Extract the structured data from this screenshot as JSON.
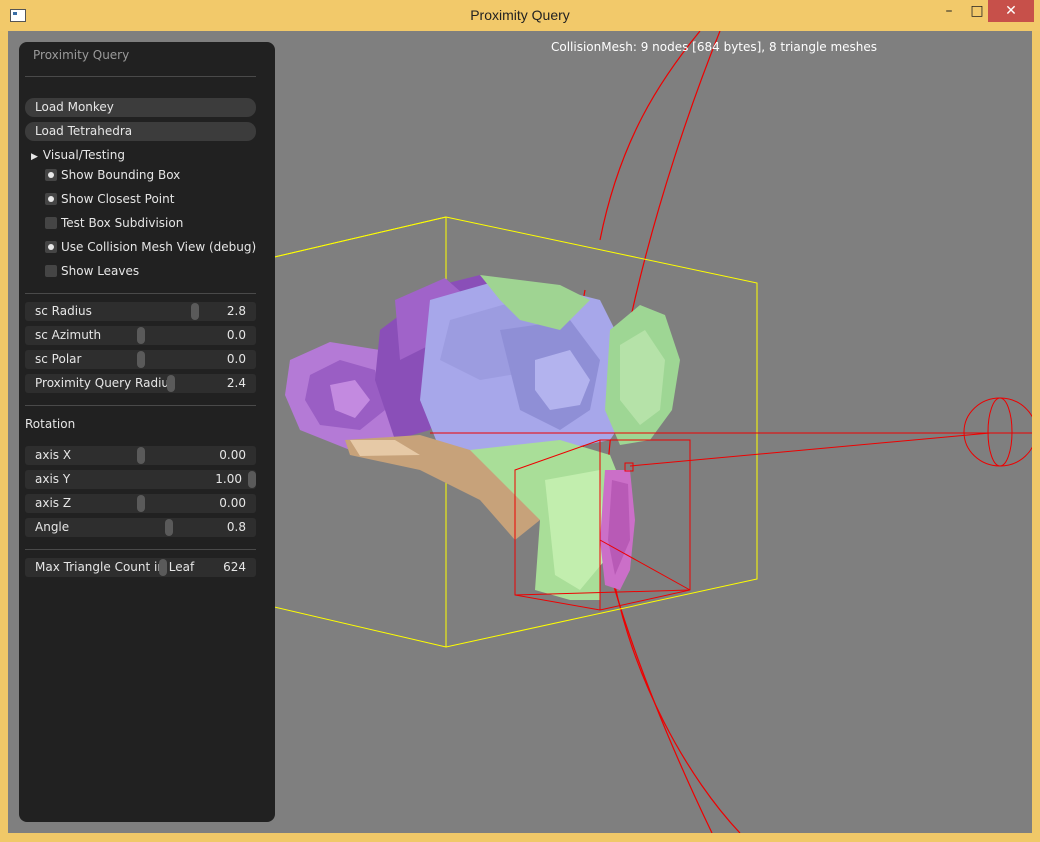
{
  "window": {
    "title": "Proximity Query",
    "controls": {
      "minimize": "–",
      "maximize": "□",
      "close": "✕"
    },
    "icon": "app-window-icon"
  },
  "viewport": {
    "info": "CollisionMesh: 9 nodes [684 bytes], 8 triangle meshes",
    "background": "#7f7f7f"
  },
  "panel": {
    "title": "Proximity Query",
    "buttons": {
      "load_monkey": "Load Monkey",
      "load_tetrahedra": "Load Tetrahedra"
    },
    "visual_testing": {
      "label": "Visual/Testing",
      "expanded_icon": "triangle-right-icon",
      "options": [
        {
          "label": "Show Bounding Box",
          "checked": true
        },
        {
          "label": "Show Closest Point",
          "checked": true
        },
        {
          "label": "Test Box Subdivision",
          "checked": false
        },
        {
          "label": "Use Collision Mesh View (debug)",
          "checked": true
        },
        {
          "label": "Show Leaves",
          "checked": false
        }
      ]
    },
    "sliders": {
      "sc_radius": {
        "label": "sc Radius",
        "value": "2.8",
        "fraction": 0.75
      },
      "sc_azimuth": {
        "label": "sc Azimuth",
        "value": "0.0",
        "fraction": 0.5
      },
      "sc_polar": {
        "label": "sc Polar",
        "value": "0.0",
        "fraction": 0.5
      },
      "pq_radius": {
        "label": "Proximity Query Radius",
        "value": "2.4",
        "fraction": 0.62
      }
    },
    "rotation": {
      "heading": "Rotation",
      "axis_x": {
        "label": "axis X",
        "value": "0.00",
        "fraction": 0.5
      },
      "axis_y": {
        "label": "axis Y",
        "value": "1.00",
        "fraction": 1.0
      },
      "axis_z": {
        "label": "axis Z",
        "value": "0.00",
        "fraction": 0.5
      },
      "angle": {
        "label": "Angle",
        "value": "0.8",
        "fraction": 0.62
      }
    },
    "max_triangles": {
      "label": "Max Triangle Count in Leaf",
      "value": "624",
      "fraction": 0.59
    }
  },
  "colors": {
    "title_bar": "#f2c96a",
    "close_button": "#c7504a",
    "panel": "#212121",
    "bounding_box": "#ffff00",
    "query": "#ff0000"
  }
}
